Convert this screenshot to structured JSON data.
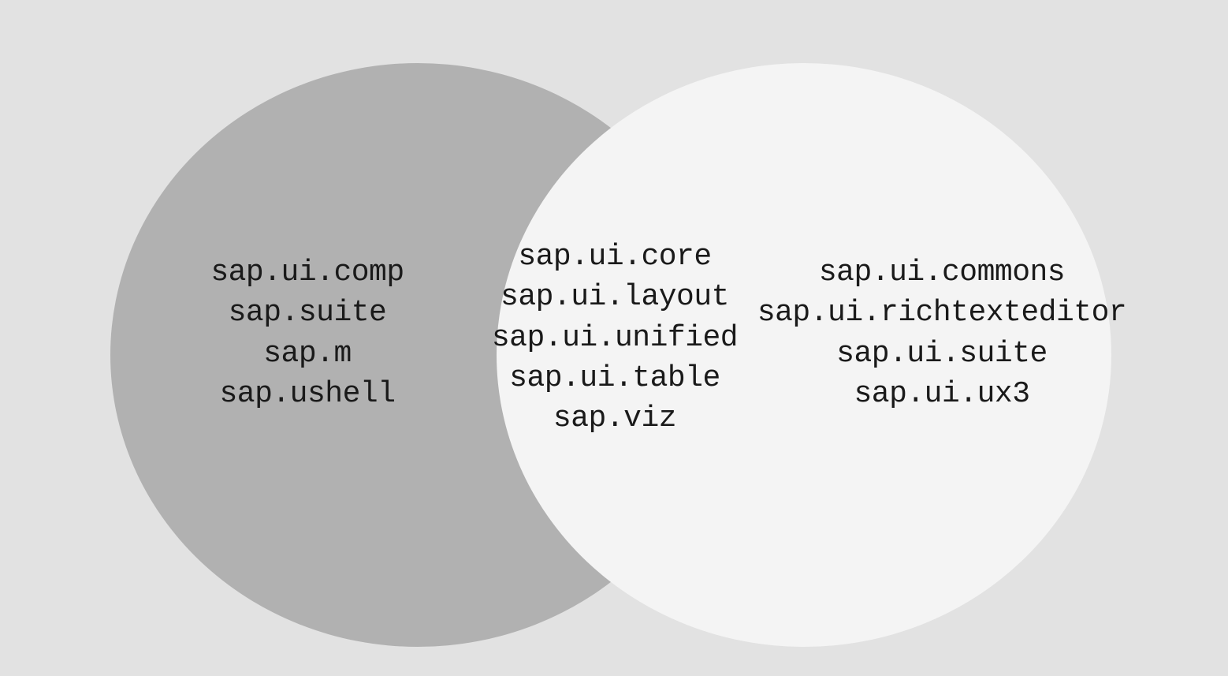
{
  "venn": {
    "left": {
      "items": [
        "sap.ui.comp",
        "sap.suite",
        "sap.m",
        "sap.ushell"
      ]
    },
    "center": {
      "items": [
        "sap.ui.core",
        "sap.ui.layout",
        "sap.ui.unified",
        "sap.ui.table",
        "sap.viz"
      ]
    },
    "right": {
      "items": [
        "sap.ui.commons",
        "sap.ui.richtexteditor",
        "sap.ui.suite",
        "sap.ui.ux3"
      ]
    }
  },
  "colors": {
    "background": "#e2e2e2",
    "circleLeft": "#b1b1b1",
    "circleRight": "#f4f4f4",
    "text": "#1a1a1a"
  }
}
